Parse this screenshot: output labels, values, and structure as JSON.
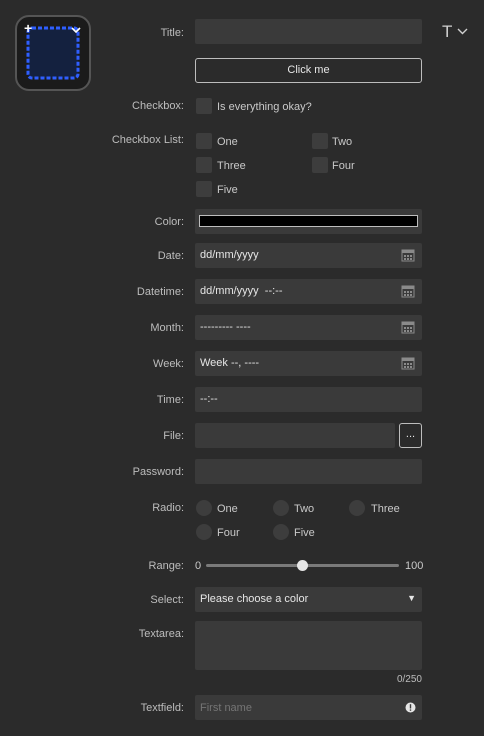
{
  "header": {
    "text_format_glyph": "T"
  },
  "title": {
    "label": "Title:",
    "value": ""
  },
  "button": {
    "label": "Click me"
  },
  "checkbox": {
    "label": "Checkbox:",
    "text": "Is everything okay?"
  },
  "checkbox_list": {
    "label": "Checkbox List:",
    "options": [
      "One",
      "Two",
      "Three",
      "Four",
      "Five"
    ]
  },
  "color": {
    "label": "Color:",
    "value": "#000000"
  },
  "date": {
    "label": "Date:",
    "value": "dd/mm/yyyy"
  },
  "datetime": {
    "label": "Datetime:",
    "value": "dd/mm/yyyy  --:--"
  },
  "month": {
    "label": "Month:",
    "value": "--------- ----"
  },
  "week": {
    "label": "Week:",
    "value": "Week --, ----"
  },
  "time": {
    "label": "Time:",
    "value": "--:--"
  },
  "file": {
    "label": "File:",
    "button": "..."
  },
  "password": {
    "label": "Password:"
  },
  "radio": {
    "label": "Radio:",
    "options": [
      "One",
      "Two",
      "Three",
      "Four",
      "Five"
    ]
  },
  "range": {
    "label": "Range:",
    "min": "0",
    "max": "100",
    "value": 50
  },
  "select": {
    "label": "Select:",
    "value": "Please choose a color"
  },
  "textarea": {
    "label": "Textarea:",
    "counter": "0/250"
  },
  "textfield": {
    "label": "Textfield:",
    "placeholder": "First name"
  },
  "colors": {
    "accent": "#2f5fff",
    "background": "#2b2b2b",
    "field": "#3a3a3a"
  }
}
